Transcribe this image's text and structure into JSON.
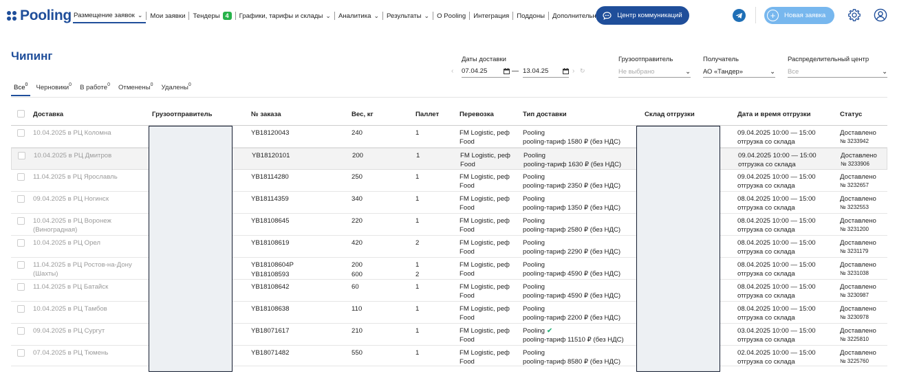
{
  "nav": {
    "logo": "Pooling",
    "items": [
      {
        "label": "Размещение заявок",
        "dropdown": true,
        "active": true
      },
      {
        "label": "Мои заявки"
      },
      {
        "label": "Тендеры",
        "badge": "4"
      },
      {
        "label": "Графики, тарифы и склады",
        "dropdown": true
      },
      {
        "label": "Аналитика",
        "dropdown": true
      },
      {
        "label": "Результаты",
        "dropdown": true
      },
      {
        "label": "О Pooling"
      },
      {
        "label": "Интеграция"
      },
      {
        "label": "Поддоны"
      },
      {
        "label": "Дополнительно",
        "dropdown": true
      }
    ],
    "comm_button": "Центр коммуникаций",
    "new_button": "Новая заявка",
    "icons": [
      "chat-icon",
      "telegram-icon",
      "plus-icon",
      "gear-icon",
      "user-icon"
    ],
    "accent": "#1f4e9a",
    "badge_color": "#27b24a"
  },
  "page": {
    "title": "Чипинг"
  },
  "filters": {
    "dates_label": "Даты доставки",
    "date_from": "07.04.25",
    "date_to": "13.04.25",
    "date_sep": "—",
    "shipper_label": "Грузоотправитель",
    "shipper_placeholder": "Не выбрано",
    "receiver_label": "Получатель",
    "receiver_value": "АО «Тандер»",
    "dc_label": "Распределительный центр",
    "dc_placeholder": "Все"
  },
  "tabs": [
    {
      "label": "Все",
      "count": "0",
      "active": true
    },
    {
      "label": "Черновики",
      "count": "0"
    },
    {
      "label": "В работе",
      "count": "0"
    },
    {
      "label": "Отменены",
      "count": "0"
    },
    {
      "label": "Удалены",
      "count": "0"
    }
  ],
  "table": {
    "headers": [
      "Доставка",
      "Грузоотправитель",
      "№ заказа",
      "Вес, кг",
      "Паллет",
      "Перевозка",
      "Тип доставки",
      "Склад отгрузки",
      "Дата и время отгрузки",
      "Статус"
    ],
    "rows": [
      {
        "delivery": [
          "10.04.2025 в РЦ Коломна"
        ],
        "orders": [
          "YB18120043"
        ],
        "weights": [
          "240"
        ],
        "pallets": [
          "1"
        ],
        "carrier": [
          "FM Logistic, реф",
          "Food"
        ],
        "type": "Pooling",
        "tariff": "pooling-тариф 1580 ₽ (без НДС)",
        "ship": [
          "09.04.2025 10:00 — 15:00",
          "отгрузка со склада"
        ],
        "status": "Доставлено",
        "status_num": "№ 3233942"
      },
      {
        "delivery": [
          "10.04.2025 в РЦ Дмитров"
        ],
        "orders": [
          "YB18120101"
        ],
        "weights": [
          "200"
        ],
        "pallets": [
          "1"
        ],
        "carrier": [
          "FM Logistic, реф",
          "Food"
        ],
        "type": "Pooling",
        "tariff": "pooling-тариф 1630 ₽ (без НДС)",
        "ship": [
          "09.04.2025 10:00 — 15:00",
          "отгрузка со склада"
        ],
        "status": "Доставлено",
        "status_num": "№ 3233906",
        "highlight": true
      },
      {
        "delivery": [
          "11.04.2025 в РЦ Ярославль"
        ],
        "orders": [
          "YB18114280"
        ],
        "weights": [
          "250"
        ],
        "pallets": [
          "1"
        ],
        "carrier": [
          "FM Logistic, реф",
          "Food"
        ],
        "type": "Pooling",
        "tariff": "pooling-тариф 2350 ₽ (без НДС)",
        "ship": [
          "09.04.2025 10:00 — 15:00",
          "отгрузка со склада"
        ],
        "status": "Доставлено",
        "status_num": "№ 3232657"
      },
      {
        "delivery": [
          "09.04.2025 в РЦ Ногинск"
        ],
        "orders": [
          "YB18114359"
        ],
        "weights": [
          "340"
        ],
        "pallets": [
          "1"
        ],
        "carrier": [
          "FM Logistic, реф",
          "Food"
        ],
        "type": "Pooling",
        "tariff": "pooling-тариф 1350 ₽ (без НДС)",
        "ship": [
          "08.04.2025 10:00 — 15:00",
          "отгрузка со склада"
        ],
        "status": "Доставлено",
        "status_num": "№ 3232553"
      },
      {
        "delivery": [
          "10.04.2025 в РЦ Воронеж",
          "(Виноградная)"
        ],
        "orders": [
          "YB18108645"
        ],
        "weights": [
          "220"
        ],
        "pallets": [
          "1"
        ],
        "carrier": [
          "FM Logistic, реф",
          "Food"
        ],
        "type": "Pooling",
        "tariff": "pooling-тариф 2580 ₽ (без НДС)",
        "ship": [
          "08.04.2025 10:00 — 15:00",
          "отгрузка со склада"
        ],
        "status": "Доставлено",
        "status_num": "№ 3231200"
      },
      {
        "delivery": [
          "10.04.2025 в РЦ Орел"
        ],
        "orders": [
          "YB18108619"
        ],
        "weights": [
          "420"
        ],
        "pallets": [
          "2"
        ],
        "carrier": [
          "FM Logistic, реф",
          "Food"
        ],
        "type": "Pooling",
        "tariff": "pooling-тариф 2290 ₽ (без НДС)",
        "ship": [
          "08.04.2025 10:00 — 15:00",
          "отгрузка со склада"
        ],
        "status": "Доставлено",
        "status_num": "№ 3231179"
      },
      {
        "delivery": [
          "11.04.2025 в РЦ Ростов-на-Дону",
          "(Шахты)"
        ],
        "orders": [
          "YB18108604P",
          "YB18108593"
        ],
        "weights": [
          "200",
          "600"
        ],
        "pallets": [
          "1",
          "2"
        ],
        "carrier": [
          "FM Logistic, реф",
          "Food"
        ],
        "type": "Pooling",
        "tariff": "pooling-тариф 4590 ₽ (без НДС)",
        "ship": [
          "08.04.2025 10:00 — 15:00",
          "отгрузка со склада"
        ],
        "status": "Доставлено",
        "status_num": "№ 3231038"
      },
      {
        "delivery": [
          "11.04.2025 в РЦ Батайск"
        ],
        "orders": [
          "YB18108642"
        ],
        "weights": [
          "60"
        ],
        "pallets": [
          "1"
        ],
        "carrier": [
          "FM Logistic, реф",
          "Food"
        ],
        "type": "Pooling",
        "tariff": "pooling-тариф 4590 ₽ (без НДС)",
        "ship": [
          "08.04.2025 10:00 — 15:00",
          "отгрузка со склада"
        ],
        "status": "Доставлено",
        "status_num": "№ 3230987"
      },
      {
        "delivery": [
          "10.04.2025 в РЦ Тамбов"
        ],
        "orders": [
          "YB18108638"
        ],
        "weights": [
          "110"
        ],
        "pallets": [
          "1"
        ],
        "carrier": [
          "FM Logistic, реф",
          "Food"
        ],
        "type": "Pooling",
        "tariff": "pooling-тариф 2200 ₽ (без НДС)",
        "ship": [
          "08.04.2025 10:00 — 15:00",
          "отгрузка со склада"
        ],
        "status": "Доставлено",
        "status_num": "№ 3230978"
      },
      {
        "delivery": [
          "09.04.2025 в РЦ Сургут"
        ],
        "orders": [
          "YB18071617"
        ],
        "weights": [
          "210"
        ],
        "pallets": [
          "1"
        ],
        "carrier": [
          "FM Logistic, реф",
          "Food"
        ],
        "type": "Pooling",
        "type_check": "✔",
        "tariff": "pooling-тариф 11510 ₽ (без НДС)",
        "ship": [
          "03.04.2025 10:00 — 15:00",
          "отгрузка со склада"
        ],
        "status": "Доставлено",
        "status_num": "№ 3225810"
      },
      {
        "delivery": [
          "07.04.2025 в РЦ Тюмень"
        ],
        "orders": [
          "YB18071482"
        ],
        "weights": [
          "550"
        ],
        "pallets": [
          "1"
        ],
        "carrier": [
          "FM Logistic, реф",
          "Food"
        ],
        "type": "Pooling",
        "tariff": "pooling-тариф 8580 ₽ (без НДС)",
        "ship": [
          "02.04.2025 10:00 — 15:00",
          "отгрузка со склада"
        ],
        "status": "Доставлено",
        "status_num": "№ 3225760"
      }
    ]
  }
}
